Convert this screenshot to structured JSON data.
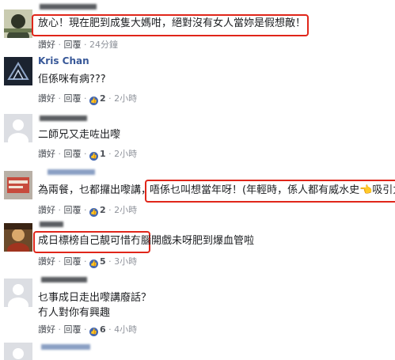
{
  "comments": [
    {
      "name": "",
      "text": "放心！現在肥到成隻大媽咁，絕對沒有女人當妳是假想敵！",
      "actions": {
        "like": "讚好",
        "reply": "回覆",
        "time": "24分鐘"
      }
    },
    {
      "name": "Kris Chan",
      "text": "佢係咪有病???",
      "actions": {
        "like": "讚好",
        "reply": "回覆",
        "count": "2",
        "time": "2小時"
      }
    },
    {
      "name": "",
      "text": "二師兄又走咗出嚟",
      "actions": {
        "like": "讚好",
        "reply": "回覆",
        "count": "1",
        "time": "2小時"
      }
    },
    {
      "name": "",
      "text_prefix": "為兩餐，乜都攞出嚟講，",
      "text_highlight": "唔係乜叫想當年呀！(年輕時，係人都有威水史👈吸引力",
      "actions": {
        "like": "讚好",
        "reply": "回覆",
        "count": "2",
        "time": "2小時"
      }
    },
    {
      "name": "",
      "text_highlight": "成日標榜自己靚可惜冇腦",
      "text_suffix": "開戲未呀肥到爆血管啦",
      "actions": {
        "like": "讚好",
        "reply": "回覆",
        "count": "5",
        "time": "3小時"
      }
    },
    {
      "name": "",
      "text_line1": "乜事成日走出嚟講廢話？",
      "text_line2": "冇人對你有興趣",
      "actions": {
        "like": "讚好",
        "reply": "回覆",
        "count": "6",
        "time": "4小時"
      }
    }
  ],
  "colors": {
    "highlight": "#e0261a",
    "link": "#385898",
    "meta": "#90949c",
    "like_badge": "#4267b2"
  },
  "icons": {
    "like_badge": "thumbs-up-icon"
  }
}
